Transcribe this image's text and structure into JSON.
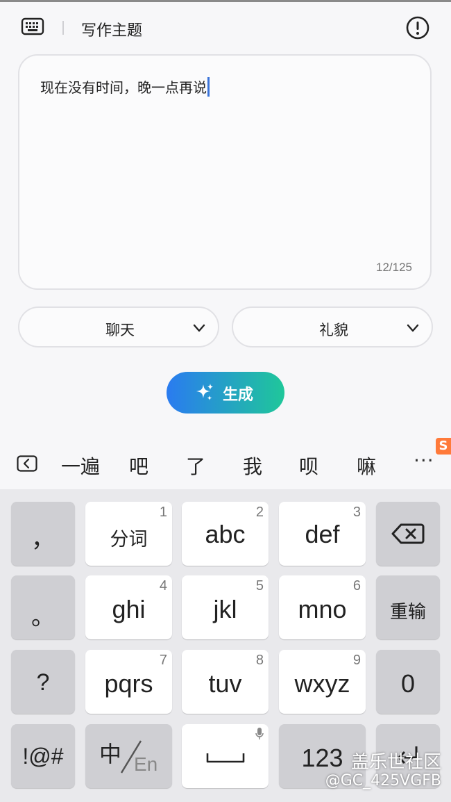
{
  "header": {
    "title": "写作主题"
  },
  "textbox": {
    "text": "现在没有时间，晚一点再说",
    "counter": "12/125"
  },
  "dropdowns": [
    {
      "label": "聊天"
    },
    {
      "label": "礼貌"
    }
  ],
  "generate": {
    "label": "生成"
  },
  "candidates": {
    "items": [
      "一遍",
      "吧",
      "了",
      "我",
      "呗",
      "嘛"
    ],
    "more": "···",
    "badge": "S"
  },
  "keyboard": {
    "punct_comma": "，",
    "punct_period": "。",
    "punct_question": "?",
    "symbols": "!@#",
    "fenci": "分词",
    "keys": [
      {
        "label": "abc",
        "num": "2"
      },
      {
        "label": "def",
        "num": "3"
      },
      {
        "label": "ghi",
        "num": "4"
      },
      {
        "label": "jkl",
        "num": "5"
      },
      {
        "label": "mno",
        "num": "6"
      },
      {
        "label": "pqrs",
        "num": "7"
      },
      {
        "label": "tuv",
        "num": "8"
      },
      {
        "label": "wxyz",
        "num": "9"
      }
    ],
    "fenci_num": "1",
    "retype": "重输",
    "zero": "0",
    "lang_zh": "中",
    "lang_en": "En",
    "numbers": "123"
  },
  "watermark": {
    "line1": "盖乐世社区",
    "line2": "@GC_425VGFB"
  }
}
